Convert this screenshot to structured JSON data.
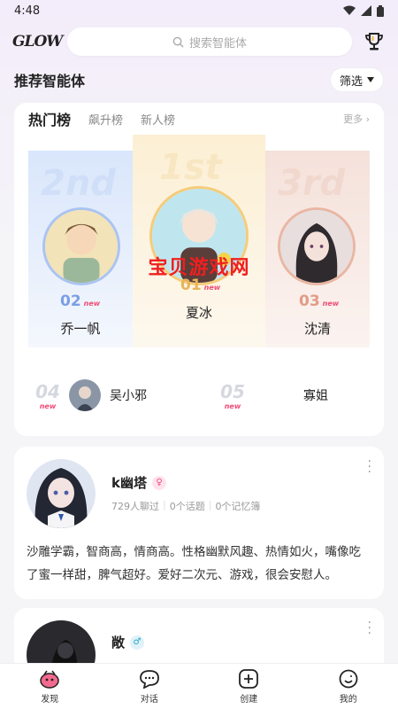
{
  "status": {
    "time": "4:48"
  },
  "header": {
    "logo": "GLOW",
    "search_placeholder": "搜索智能体"
  },
  "section": {
    "title": "推荐智能体",
    "filter_label": "筛选"
  },
  "ranking": {
    "tabs": [
      {
        "label": "热门榜"
      },
      {
        "label": "飙升榜"
      },
      {
        "label": "新人榜"
      }
    ],
    "more_label": "更多",
    "podium": [
      {
        "rank": "02",
        "ghost": "2nd",
        "new": "new",
        "name": "乔一帆"
      },
      {
        "rank": "01",
        "ghost": "1st",
        "new": "new",
        "name": "夏冰"
      },
      {
        "rank": "03",
        "ghost": "3rd",
        "new": "new",
        "name": "沈清"
      }
    ],
    "lower": [
      {
        "rank": "04",
        "new": "new",
        "name": "吴小邪"
      },
      {
        "rank": "05",
        "new": "new",
        "name": "寡姐"
      }
    ],
    "watermark": "宝贝游戏网"
  },
  "agents": [
    {
      "name": "k幽塔",
      "gender": "♀",
      "chat_count": "729人聊过",
      "topics": "0个话题",
      "memories": "0个记忆簿",
      "desc": "沙雕学霸，智商高，情商高。性格幽默风趣、热情如火，嘴像吃了蜜一样甜，脾气超好。爱好二次元、游戏，很会安慰人。"
    },
    {
      "name": "敞",
      "gender": "♂"
    }
  ],
  "tabbar": [
    {
      "label": "发现"
    },
    {
      "label": "对话"
    },
    {
      "label": "创建"
    },
    {
      "label": "我的"
    }
  ],
  "colors": {
    "accent_pink": "#f04b75",
    "gold": "#e7b45c",
    "silver_blue": "#7c9ee6",
    "bronze": "#e29b88"
  }
}
